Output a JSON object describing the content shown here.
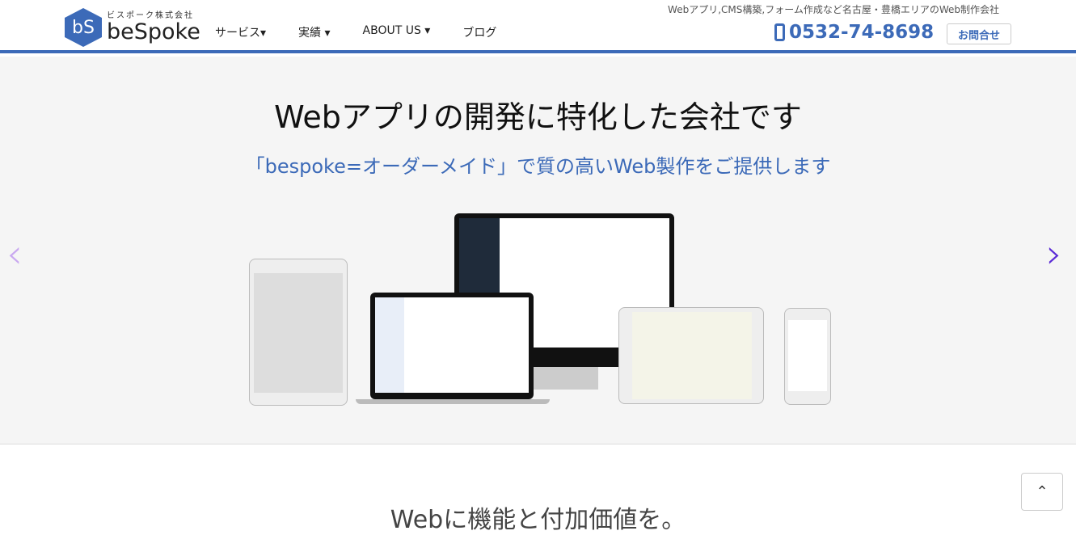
{
  "header": {
    "logo_mark": "bS",
    "logo_sub": "ビスポーク株式会社",
    "logo_name": "beSpoke",
    "nav": [
      {
        "label": "サービス▾"
      },
      {
        "label": "実績 ▾"
      },
      {
        "label": "ABOUT US ▾"
      },
      {
        "label": "ブログ"
      }
    ],
    "tagline": "Webアプリ,CMS構築,フォーム作成など名古屋・豊橋エリアのWeb制作会社",
    "phone": "0532-74-8698",
    "contact_label": "お問合せ"
  },
  "hero": {
    "title": "Webアプリの開発に特化した会社です",
    "subtitle": "「bespoke=オーダーメイド」で質の高いWeb製作をご提供します",
    "prev": "‹",
    "next": "›"
  },
  "section": {
    "title": "Webに機能と付加価値を。"
  },
  "back_to_top": "⌃",
  "colors": {
    "accent": "#3c6ab8",
    "arrow_prev": "#c9a8f0",
    "arrow_next": "#5b2bd6"
  }
}
